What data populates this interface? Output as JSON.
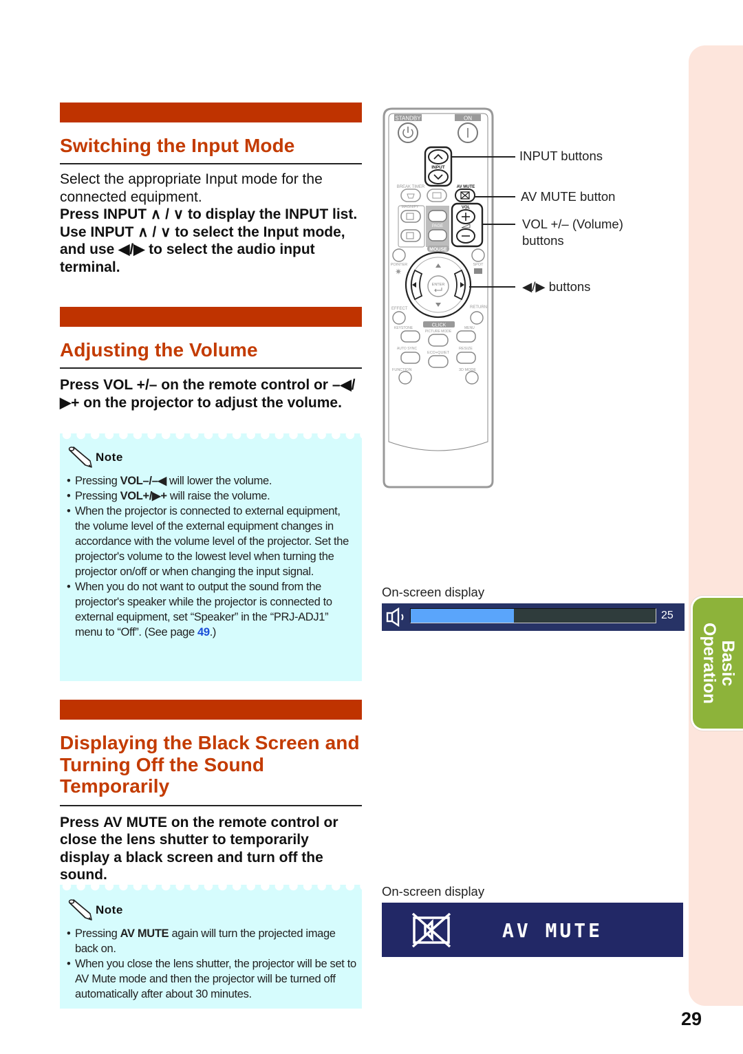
{
  "page": {
    "number": "29",
    "side_tab": {
      "line1": "Basic",
      "line2": "Operation"
    },
    "colors": {
      "heading": "#c33b00",
      "bar": "#bf3300",
      "note_bg": "#d6fcfd",
      "tab": "#8db33a",
      "strip": "#fde5dc",
      "link": "#1c4fd8"
    }
  },
  "section_input": {
    "title": "Switching the Input Mode",
    "intro": "Select the appropriate Input mode for the connected equipment.",
    "step1": {
      "pre": "Press ",
      "key": "INPUT",
      "arrows": " ∧ / ∨ ",
      "post": "to display the INPUT list."
    },
    "step2": {
      "pre": "Use ",
      "key": "INPUT",
      "arrows": " ∧ / ∨ ",
      "post": "to select the Input mode, and use ◀/▶ to select the audio input terminal."
    }
  },
  "section_volume": {
    "title": "Adjusting the Volume",
    "instruction": {
      "pre": "Press ",
      "key": "VOL +/–",
      "post": " on the remote control or –◀/▶+ on the projector to adjust the volume."
    },
    "note_label": "Note",
    "notes": [
      {
        "pre": "Pressing ",
        "key": "VOL–/–◀",
        "post": " will lower the volume."
      },
      {
        "pre": "Pressing ",
        "key": "VOL+/▶+",
        "post": " will raise the volume."
      },
      {
        "pre": "When the projector is connected to external equipment, the volume level of the external equipment changes in accordance with the volume level of the projector. Set the projector's volume to the lowest level when turning the projector on/off or when changing the input signal.",
        "key": "",
        "post": ""
      },
      {
        "pre": "When you do not want to output the sound from the projector's speaker while the projector is connected to external equipment, set “Speaker” in the “PRJ-ADJ1” menu to “Off”. (See page ",
        "link": "49",
        "post": ".)"
      }
    ]
  },
  "section_mute": {
    "title": "Displaying the Black Screen and Turning Off the Sound Temporarily",
    "instruction": {
      "pre": "Press ",
      "key": "AV MUTE",
      "post": " on the remote control or close the lens shutter to temporarily display a black screen and turn off the sound."
    },
    "note_label": "Note",
    "notes": [
      {
        "pre": "Pressing ",
        "key": "AV MUTE",
        "post": " again will turn the projected image back on."
      },
      {
        "pre": "When you close the lens shutter, the projector will be set to AV Mute mode and then the projector will be turned off automatically after about 30 minutes.",
        "key": "",
        "post": ""
      }
    ]
  },
  "remote": {
    "labels": {
      "standby": "STANDBY",
      "on": "ON",
      "input": "INPUT",
      "break_timer": "BREAK TIMER",
      "av_mute": "AV MUTE",
      "magnify": "MAGNIFY",
      "vol": "VOL",
      "page": "PAGE",
      "mouse": "MOUSE",
      "pointer": "POINTER",
      "spot": "SPOT",
      "enter": "ENTER",
      "effect": "EFFECT",
      "return": "RETURN",
      "click": "CLICK",
      "keystone": "KEYSTONE",
      "picture_mode": "PICTURE MODE",
      "menu": "MENU",
      "auto_sync": "AUTO SYNC",
      "eco_quiet": "ECO+QUIET",
      "resize": "RESIZE",
      "function": "FUNCTION",
      "mode_3d": "3D MODE"
    },
    "callouts": {
      "input": "INPUT buttons",
      "av_mute": "AV MUTE button",
      "vol_line1": "VOL +/– (Volume)",
      "vol_line2": "buttons",
      "arrows": "◀/▶ buttons"
    }
  },
  "osd_volume": {
    "caption": "On-screen display",
    "icon": "speaker-icon",
    "level_fraction": 0.42,
    "value": "25"
  },
  "osd_mute": {
    "caption": "On-screen display",
    "icon": "av-mute-icon",
    "text": "AV MUTE"
  }
}
